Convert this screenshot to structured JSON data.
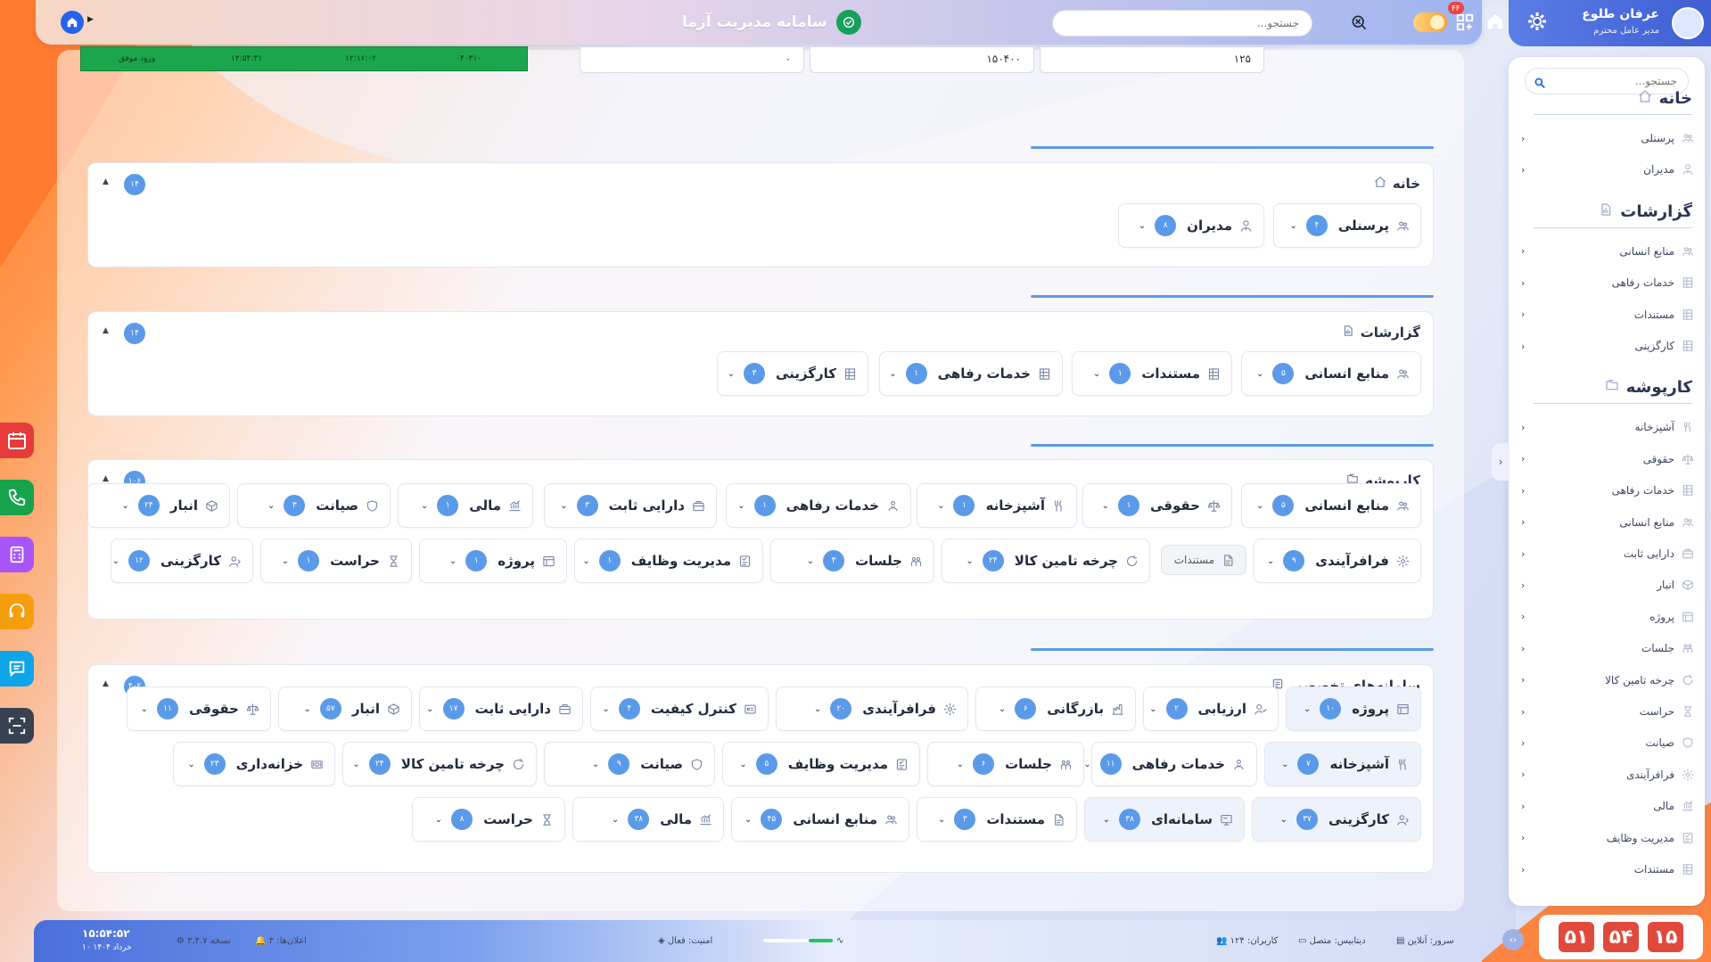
{
  "header": {
    "app_title": "سامانه مدیریت آزما",
    "search_placeholder": "جستجو...",
    "badge": "FF"
  },
  "profile": {
    "name": "عرفان طلوع",
    "role": "مدیر عامل محترم"
  },
  "sidebar": {
    "search_placeholder": "جستجو...",
    "sections": [
      {
        "title": "خانه",
        "items": [
          "پرسنلی",
          "مدیران"
        ]
      },
      {
        "title": "گزارشات",
        "items": [
          "منابع انسانی",
          "خدمات رفاهی",
          "مستندات",
          "کارگزینی"
        ]
      },
      {
        "title": "کارپوشه",
        "items": [
          "آشپزخانه",
          "حقوقی",
          "خدمات رفاهی",
          "منابع انسانی",
          "دارایی ثابت",
          "انبار",
          "پروژه",
          "جلسات",
          "چرخه تامین کالا",
          "حراست",
          "صیانت",
          "فرافرآیندی",
          "مالی",
          "مدیریت وظایف",
          "مستندات"
        ]
      }
    ]
  },
  "top_fragment": {
    "login_row": [
      "ورود موفق",
      "۱۲:۵۴:۳۱",
      "۱۲:۱۶:۰۲",
      "۰۴۰۳۱۰"
    ],
    "stat_values": [
      "۰",
      "۱۵۰۴۰۰",
      "۱۲۵"
    ]
  },
  "sections": [
    {
      "title": "خانه",
      "count": "۱۴",
      "rows": [
        [
          {
            "label": "پرسنلی",
            "count": "۴",
            "icon": "users-icon"
          },
          {
            "label": "مدیران",
            "count": "۸",
            "icon": "user-tie-icon"
          }
        ]
      ]
    },
    {
      "title": "گزارشات",
      "count": "۱۴",
      "rows": [
        [
          {
            "label": "منابع انسانی",
            "count": "۵",
            "icon": "users-icon"
          },
          {
            "label": "مستندات",
            "count": "۱",
            "icon": "table-icon"
          },
          {
            "label": "خدمات رفاهی",
            "count": "۱",
            "icon": "table-icon"
          },
          {
            "label": "کارگزینی",
            "count": "۳",
            "icon": "table-icon"
          }
        ]
      ]
    },
    {
      "title": "کارپوشه",
      "count": "۱۰۶",
      "rows": [
        [
          {
            "label": "منابع انسانی",
            "count": "۵",
            "icon": "users-icon"
          },
          {
            "label": "حقوقی",
            "count": "۱",
            "icon": "scale-icon"
          },
          {
            "label": "آشپزخانه",
            "count": "۱",
            "icon": "kitchen-icon"
          },
          {
            "label": "خدمات رفاهی",
            "count": "۱",
            "icon": "welfare-icon"
          },
          {
            "label": "دارایی ثابت",
            "count": "۳",
            "icon": "asset-icon"
          },
          {
            "label": "مالی",
            "count": "۱",
            "icon": "finance-icon"
          },
          {
            "label": "صیانت",
            "count": "۳",
            "icon": "shield-icon"
          },
          {
            "label": "انبار",
            "count": "۲۴",
            "icon": "box-icon"
          }
        ],
        [
          {
            "label": "فرافرآیندی",
            "count": "۹",
            "icon": "process-icon"
          },
          {
            "label": "مستندات",
            "count": "",
            "icon": "document-icon",
            "small": true
          },
          {
            "label": "چرخه تامین کالا",
            "count": "۲۴",
            "icon": "cycle-icon"
          },
          {
            "label": "جلسات",
            "count": "۳",
            "icon": "meeting-icon"
          },
          {
            "label": "مدیریت وظایف",
            "count": "۱",
            "icon": "tasks-icon"
          },
          {
            "label": "پروژه",
            "count": "۱",
            "icon": "project-icon"
          },
          {
            "label": "حراست",
            "count": "۱",
            "icon": "guard-icon"
          },
          {
            "label": "کارگزینی",
            "count": "۱۲",
            "icon": "staff-icon"
          }
        ]
      ]
    },
    {
      "title": "سامانه‌های تخصصی",
      "count": "۴۰۲",
      "rows": [
        [
          {
            "label": "پروژه",
            "count": "۱۰",
            "icon": "project-icon",
            "hl": true
          },
          {
            "label": "ارزیابی",
            "count": "۲",
            "icon": "evaluate-icon"
          },
          {
            "label": "بازرگانی",
            "count": "۶",
            "icon": "commerce-icon"
          },
          {
            "label": "فرافرآیندی",
            "count": "۲۰",
            "icon": "process-icon"
          },
          {
            "label": "کنترل کیفیت",
            "count": "۴",
            "icon": "quality-icon"
          },
          {
            "label": "دارایی ثابت",
            "count": "۱۷",
            "icon": "asset-icon"
          },
          {
            "label": "انبار",
            "count": "۵۷",
            "icon": "box-icon"
          },
          {
            "label": "حقوقی",
            "count": "۱۱",
            "icon": "scale-icon"
          }
        ],
        [
          {
            "label": "آشپزخانه",
            "count": "۷",
            "icon": "kitchen-icon",
            "hl": true
          },
          {
            "label": "خدمات رفاهی",
            "count": "۱۱",
            "icon": "welfare-icon"
          },
          {
            "label": "جلسات",
            "count": "۶",
            "icon": "meeting-icon"
          },
          {
            "label": "مدیریت وظایف",
            "count": "۵",
            "icon": "tasks-icon"
          },
          {
            "label": "صیانت",
            "count": "۹",
            "icon": "shield-icon"
          },
          {
            "label": "چرخه تامین کالا",
            "count": "۲۴",
            "icon": "cycle-icon"
          },
          {
            "label": "خزانه‌داری",
            "count": "۲۳",
            "icon": "treasury-icon"
          }
        ],
        [
          {
            "label": "کارگزینی",
            "count": "۳۷",
            "icon": "staff-icon",
            "hl": true
          },
          {
            "label": "سامانه‌ای",
            "count": "۳۸",
            "icon": "system-icon",
            "hl": true
          },
          {
            "label": "مستندات",
            "count": "۳",
            "icon": "document-icon"
          },
          {
            "label": "منابع انسانی",
            "count": "۴۵",
            "icon": "users-icon"
          },
          {
            "label": "مالی",
            "count": "۳۸",
            "icon": "finance-icon"
          },
          {
            "label": "حراست",
            "count": "۸",
            "icon": "guard-icon"
          }
        ]
      ]
    }
  ],
  "statusbar": {
    "server": "سرور: آنلاین",
    "database": "دیتابیس: متصل",
    "users": "کاربران: ۱۲۴",
    "security": "امنیت: فعال",
    "health_fraction": 0.35,
    "version": "نسخه ۳.۴.۷",
    "notifications": "اعلان‌ها: ۳",
    "time": "۱۵:۵۴:۵۲",
    "date": "۱۰ خرداد ۱۴۰۴"
  },
  "big_clock": [
    "۱۵",
    "۵۴",
    "۵۱"
  ],
  "colors": {
    "accent": "#5b9ae8",
    "primary": "#2563eb",
    "clock": "#e04a3c",
    "login_strip": "#1ba64d"
  }
}
